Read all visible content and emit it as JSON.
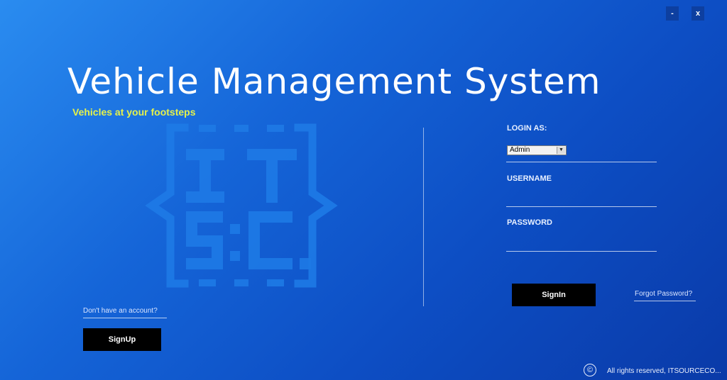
{
  "window": {
    "minimize_label": "-",
    "close_label": "x"
  },
  "header": {
    "title": "Vehicle Management System",
    "tagline": "Vehicles at your footsteps"
  },
  "logo": {
    "icon": "itsc-logo-icon",
    "text": "ITSC"
  },
  "login": {
    "login_as_label": "LOGIN AS:",
    "role_selected": "Admin",
    "username_label": "USERNAME",
    "username_value": "",
    "password_label": "PASSWORD",
    "password_value": "",
    "signin_label": "SignIn",
    "forgot_label": "Forgot Password?"
  },
  "signup": {
    "prompt": "Don't have an account?",
    "button_label": "SignUp"
  },
  "footer": {
    "copyright_symbol": "©",
    "text": "All rights reserved, ITSOURCECO..."
  },
  "colors": {
    "tagline": "#e6f24a",
    "button_bg": "#000000",
    "logo": "#1e7ae6"
  }
}
